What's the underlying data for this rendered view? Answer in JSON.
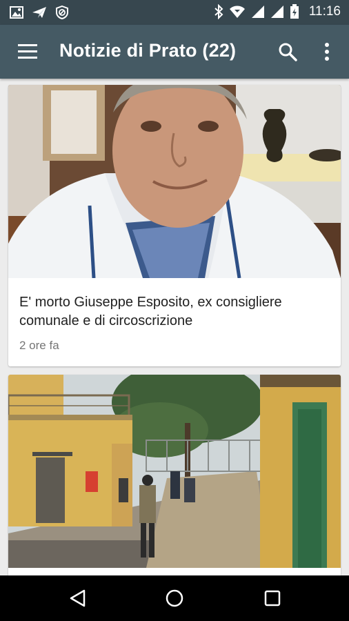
{
  "status_bar": {
    "time": "11:16",
    "left_icons": [
      "image-icon",
      "send-icon",
      "blocked-icon"
    ],
    "right_icons": [
      "bluetooth-icon",
      "wifi-icon",
      "signal-icon",
      "signal-icon",
      "battery-icon"
    ]
  },
  "app_bar": {
    "title": "Notizie di Prato (22)",
    "icons": [
      "menu-icon",
      "search-icon",
      "more-vert-icon"
    ]
  },
  "feed": {
    "articles": [
      {
        "title": "E' morto Giuseppe Esposito, ex consigliere comunale e di circoscrizione",
        "time": "2 ore fa",
        "image": "portrait of an elderly man in a white polo shirt"
      },
      {
        "title": "",
        "time": "",
        "image": "yellow buildings around a courtyard with people"
      }
    ]
  },
  "nav_bar": {
    "icons": [
      "back-icon",
      "home-icon",
      "recents-icon"
    ]
  },
  "colors": {
    "status_bar": "#37474f",
    "app_bar": "#455a64",
    "background": "#ececec",
    "nav_bar": "#000000"
  }
}
